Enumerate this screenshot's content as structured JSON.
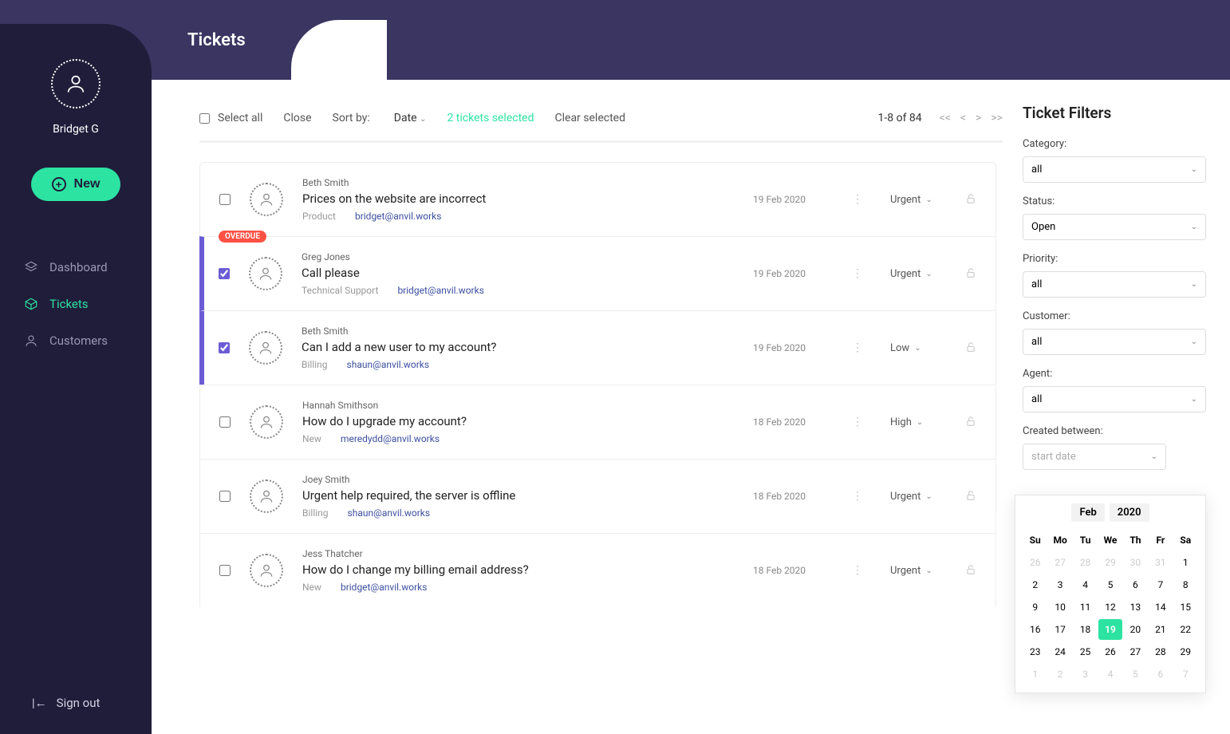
{
  "user": {
    "name": "Bridget G"
  },
  "new_button": "New",
  "nav": {
    "dashboard": "Dashboard",
    "tickets": "Tickets",
    "customers": "Customers"
  },
  "signout": "Sign out",
  "page_title": "Tickets",
  "toolbar": {
    "select_all": "Select all",
    "close": "Close",
    "sort_by": "Sort by:",
    "sort_field": "Date",
    "selected_text": "2 tickets selected",
    "clear_selected": "Clear selected",
    "range": "1-8 of 84",
    "first": "<<",
    "prev": "<",
    "next": ">",
    "last": ">>"
  },
  "tickets": [
    {
      "customer": "Beth Smith",
      "title": "Prices on the website are incorrect",
      "category": "Product",
      "agent": "bridget@anvil.works",
      "date": "19 Feb 2020",
      "priority": "Urgent",
      "checked": false,
      "overdue": false
    },
    {
      "customer": "Greg Jones",
      "title": "Call please",
      "category": "Technical Support",
      "agent": "bridget@anvil.works",
      "date": "19 Feb 2020",
      "priority": "Urgent",
      "checked": true,
      "overdue": true
    },
    {
      "customer": "Beth Smith",
      "title": "Can I add a new user to my account?",
      "category": "Billing",
      "agent": "shaun@anvil.works",
      "date": "19 Feb 2020",
      "priority": "Low",
      "checked": true,
      "overdue": false
    },
    {
      "customer": "Hannah Smithson",
      "title": "How do I upgrade my account?",
      "category": "New",
      "agent": "meredydd@anvil.works",
      "date": "18 Feb 2020",
      "priority": "High",
      "checked": false,
      "overdue": false
    },
    {
      "customer": "Joey Smith",
      "title": "Urgent help required, the server is offline",
      "category": "Billing",
      "agent": "shaun@anvil.works",
      "date": "18 Feb 2020",
      "priority": "Urgent",
      "checked": false,
      "overdue": false
    },
    {
      "customer": "Jess Thatcher",
      "title": "How do I change my billing email address?",
      "category": "New",
      "agent": "bridget@anvil.works",
      "date": "18 Feb 2020",
      "priority": "Urgent",
      "checked": false,
      "overdue": false
    }
  ],
  "overdue_label": "OVERDUE",
  "filters": {
    "heading": "Ticket Filters",
    "category_label": "Category:",
    "category_value": "all",
    "status_label": "Status:",
    "status_value": "Open",
    "priority_label": "Priority:",
    "priority_value": "all",
    "customer_label": "Customer:",
    "customer_value": "all",
    "agent_label": "Agent:",
    "agent_value": "all",
    "created_label": "Created between:",
    "start_placeholder": "start date"
  },
  "calendar": {
    "month": "Feb",
    "year": "2020",
    "dow": [
      "Su",
      "Mo",
      "Tu",
      "We",
      "Th",
      "Fr",
      "Sa"
    ],
    "weeks": [
      [
        {
          "d": 26,
          "o": true
        },
        {
          "d": 27,
          "o": true
        },
        {
          "d": 28,
          "o": true
        },
        {
          "d": 29,
          "o": true
        },
        {
          "d": 30,
          "o": true
        },
        {
          "d": 31,
          "o": true
        },
        {
          "d": 1
        }
      ],
      [
        {
          "d": 2
        },
        {
          "d": 3
        },
        {
          "d": 4
        },
        {
          "d": 5
        },
        {
          "d": 6
        },
        {
          "d": 7
        },
        {
          "d": 8
        }
      ],
      [
        {
          "d": 9
        },
        {
          "d": 10
        },
        {
          "d": 11
        },
        {
          "d": 12
        },
        {
          "d": 13
        },
        {
          "d": 14
        },
        {
          "d": 15
        }
      ],
      [
        {
          "d": 16
        },
        {
          "d": 17
        },
        {
          "d": 18
        },
        {
          "d": 19,
          "t": true
        },
        {
          "d": 20
        },
        {
          "d": 21
        },
        {
          "d": 22
        }
      ],
      [
        {
          "d": 23
        },
        {
          "d": 24
        },
        {
          "d": 25
        },
        {
          "d": 26
        },
        {
          "d": 27
        },
        {
          "d": 28
        },
        {
          "d": 29
        }
      ],
      [
        {
          "d": 1,
          "o": true
        },
        {
          "d": 2,
          "o": true
        },
        {
          "d": 3,
          "o": true
        },
        {
          "d": 4,
          "o": true
        },
        {
          "d": 5,
          "o": true
        },
        {
          "d": 6,
          "o": true
        },
        {
          "d": 7,
          "o": true
        }
      ]
    ]
  }
}
